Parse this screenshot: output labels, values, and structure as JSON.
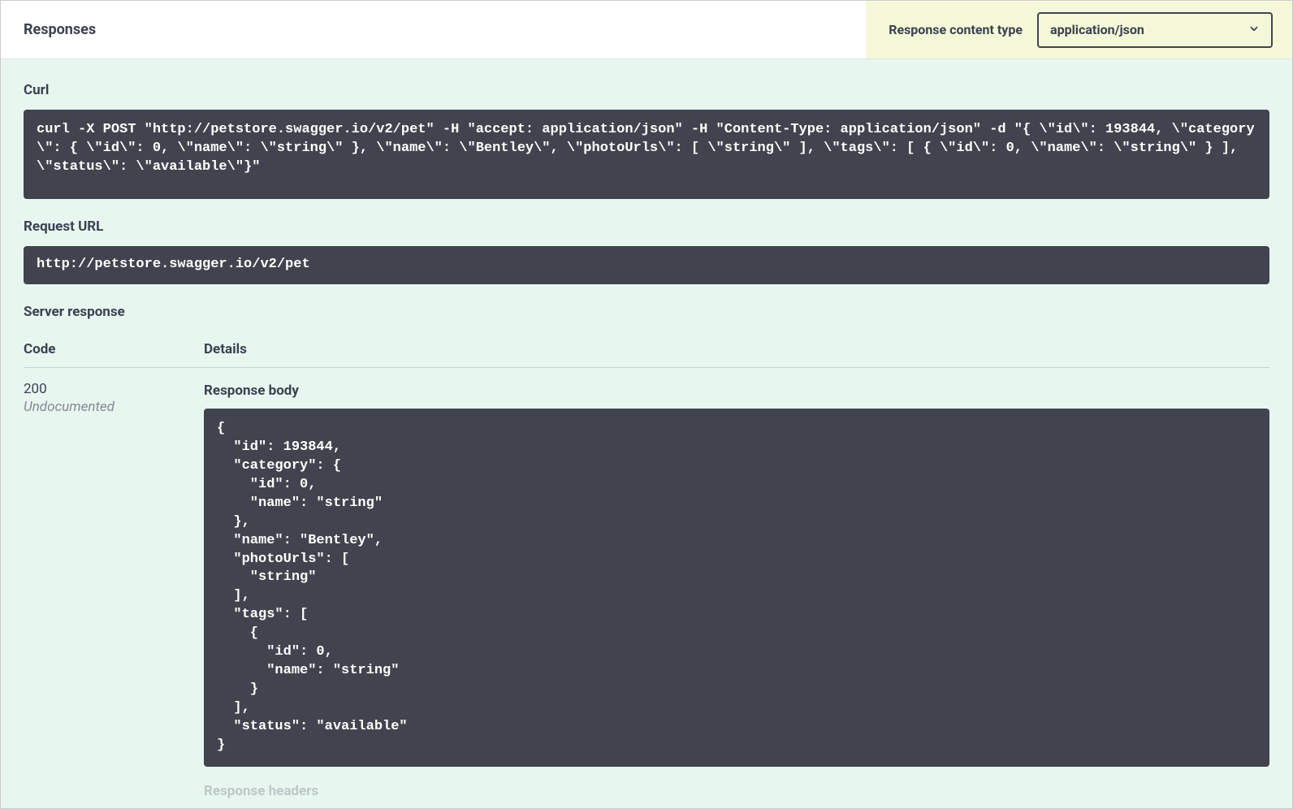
{
  "header": {
    "title": "Responses",
    "content_type_label": "Response content type",
    "content_type_value": "application/json"
  },
  "curl": {
    "label": "Curl",
    "command": "curl -X POST \"http://petstore.swagger.io/v2/pet\" -H \"accept: application/json\" -H \"Content-Type: application/json\" -d \"{ \\\"id\\\": 193844, \\\"category\\\": { \\\"id\\\": 0, \\\"name\\\": \\\"string\\\" }, \\\"name\\\": \\\"Bentley\\\", \\\"photoUrls\\\": [ \\\"string\\\" ], \\\"tags\\\": [ { \\\"id\\\": 0, \\\"name\\\": \\\"string\\\" } ], \\\"status\\\": \\\"available\\\"}\""
  },
  "request_url": {
    "label": "Request URL",
    "value": "http://petstore.swagger.io/v2/pet"
  },
  "server_response": {
    "label": "Server response",
    "columns": {
      "code": "Code",
      "details": "Details"
    },
    "entry": {
      "code": "200",
      "undocumented": "Undocumented",
      "response_body_label": "Response body",
      "response_body": "{\n  \"id\": 193844,\n  \"category\": {\n    \"id\": 0,\n    \"name\": \"string\"\n  },\n  \"name\": \"Bentley\",\n  \"photoUrls\": [\n    \"string\"\n  ],\n  \"tags\": [\n    {\n      \"id\": 0,\n      \"name\": \"string\"\n    }\n  ],\n  \"status\": \"available\"\n}",
      "response_headers_label": "Response headers"
    }
  }
}
